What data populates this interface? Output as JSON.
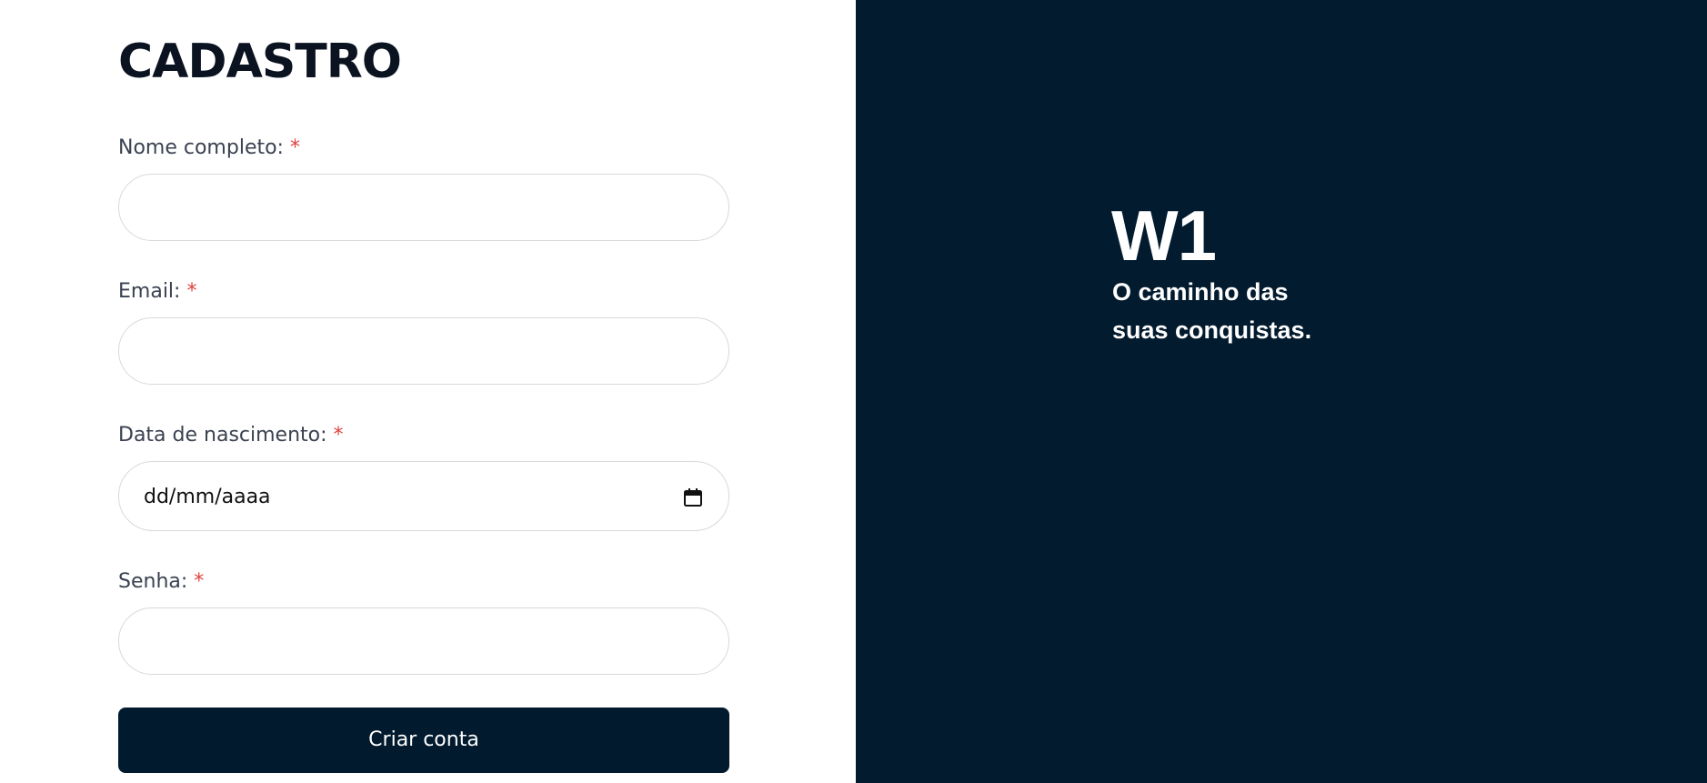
{
  "form": {
    "title": "CADASTRO",
    "required_marker": "*",
    "fields": [
      {
        "label": "Nome completo:",
        "value": ""
      },
      {
        "label": "Email:",
        "value": ""
      },
      {
        "label": "Data de nascimento:",
        "value": "dd/mm/aaaa"
      },
      {
        "label": "Senha:",
        "value": ""
      }
    ],
    "submit_label": "Criar conta"
  },
  "brand": {
    "logo": "W1",
    "tagline_line1": "O caminho das",
    "tagline_line2": "suas conquistas."
  },
  "icons": {
    "date_picker": "calendar-icon"
  },
  "colors": {
    "primary": "#011a2d",
    "panel_bg": "#021b2e",
    "required": "#e0413c",
    "title": "#0b1220",
    "label": "#3a4150",
    "border": "#d9d9d9"
  }
}
